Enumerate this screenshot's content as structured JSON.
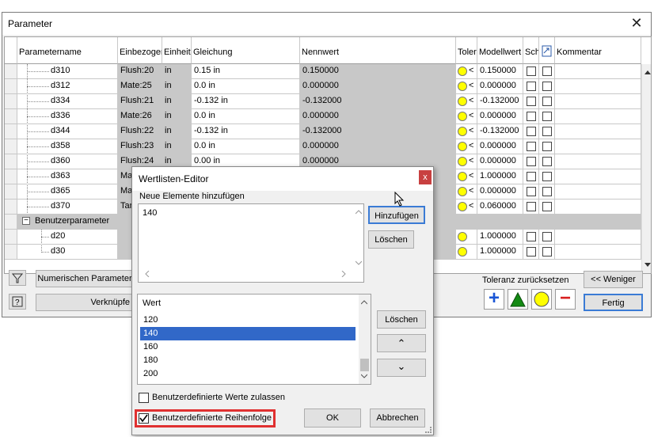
{
  "window": {
    "title": "Parameter"
  },
  "columns": [
    "Parametername",
    "Einbezogen",
    "Einheit",
    "Gleichung",
    "Nennwert",
    "Toler",
    "Modellwert",
    "Sch",
    "Kommentar"
  ],
  "rows": [
    {
      "name": "d310",
      "einb": "Flush:20",
      "unit": "in",
      "gl": "0.15 in",
      "nenn": "0.150000",
      "tol": "<",
      "model": "0.150000"
    },
    {
      "name": "d312",
      "einb": "Mate:25",
      "unit": "in",
      "gl": "0.0 in",
      "nenn": "0.000000",
      "tol": "<",
      "model": "0.000000"
    },
    {
      "name": "d334",
      "einb": "Flush:21",
      "unit": "in",
      "gl": "-0.132 in",
      "nenn": "-0.132000",
      "tol": "<",
      "model": "-0.132000"
    },
    {
      "name": "d336",
      "einb": "Mate:26",
      "unit": "in",
      "gl": "0.0 in",
      "nenn": "0.000000",
      "tol": "<",
      "model": "0.000000"
    },
    {
      "name": "d344",
      "einb": "Flush:22",
      "unit": "in",
      "gl": "-0.132 in",
      "nenn": "-0.132000",
      "tol": "<",
      "model": "-0.132000"
    },
    {
      "name": "d358",
      "einb": "Flush:23",
      "unit": "in",
      "gl": "0.0 in",
      "nenn": "0.000000",
      "tol": "<",
      "model": "0.000000"
    },
    {
      "name": "d360",
      "einb": "Flush:24",
      "unit": "in",
      "gl": "0.00 in",
      "nenn": "0.000000",
      "tol": "<",
      "model": "0.000000"
    },
    {
      "name": "d363",
      "einb": "Mat",
      "unit": "",
      "gl": "",
      "nenn": "",
      "tol": "<",
      "model": "1.000000"
    },
    {
      "name": "d365",
      "einb": "Mat",
      "unit": "",
      "gl": "",
      "nenn": "",
      "tol": "<",
      "model": "0.000000"
    },
    {
      "name": "d370",
      "einb": "Tan",
      "unit": "",
      "gl": "",
      "nenn": "",
      "tol": "<",
      "model": "0.060000"
    }
  ],
  "group": {
    "label": "Benutzerparameter",
    "toggle": "−"
  },
  "user_rows": [
    {
      "name": "d20",
      "model": "1.000000"
    },
    {
      "name": "d30",
      "model": "1.000000"
    }
  ],
  "bottom": {
    "num_param_btn": "Numerischen Parameter",
    "link_btn": "Verknüpfe",
    "tol_reset_label": "Toleranz zurücksetzen",
    "less_btn": "<< Weniger",
    "done_btn": "Fertig",
    "plus_sym": "+",
    "minus_sym": "−"
  },
  "dialog": {
    "title": "Wertlisten-Editor",
    "close": "x",
    "add_label": "Neue Elemente hinzufügen",
    "add_value": "140",
    "add_btn": "Hinzufügen",
    "delete_btn1": "Löschen",
    "list_header": "Wert",
    "list": [
      "120",
      "140",
      "160",
      "180",
      "200"
    ],
    "delete_btn2": "Löschen",
    "up": "⌃",
    "down": "⌄",
    "allow_custom": "Benutzerdefinierte Werte zulassen",
    "custom_order": "Benutzerdefinierte Reihenfolge",
    "ok": "OK",
    "cancel": "Abbrechen",
    "highlight_color": "#e03030",
    "selection_color": "#3168c8"
  }
}
